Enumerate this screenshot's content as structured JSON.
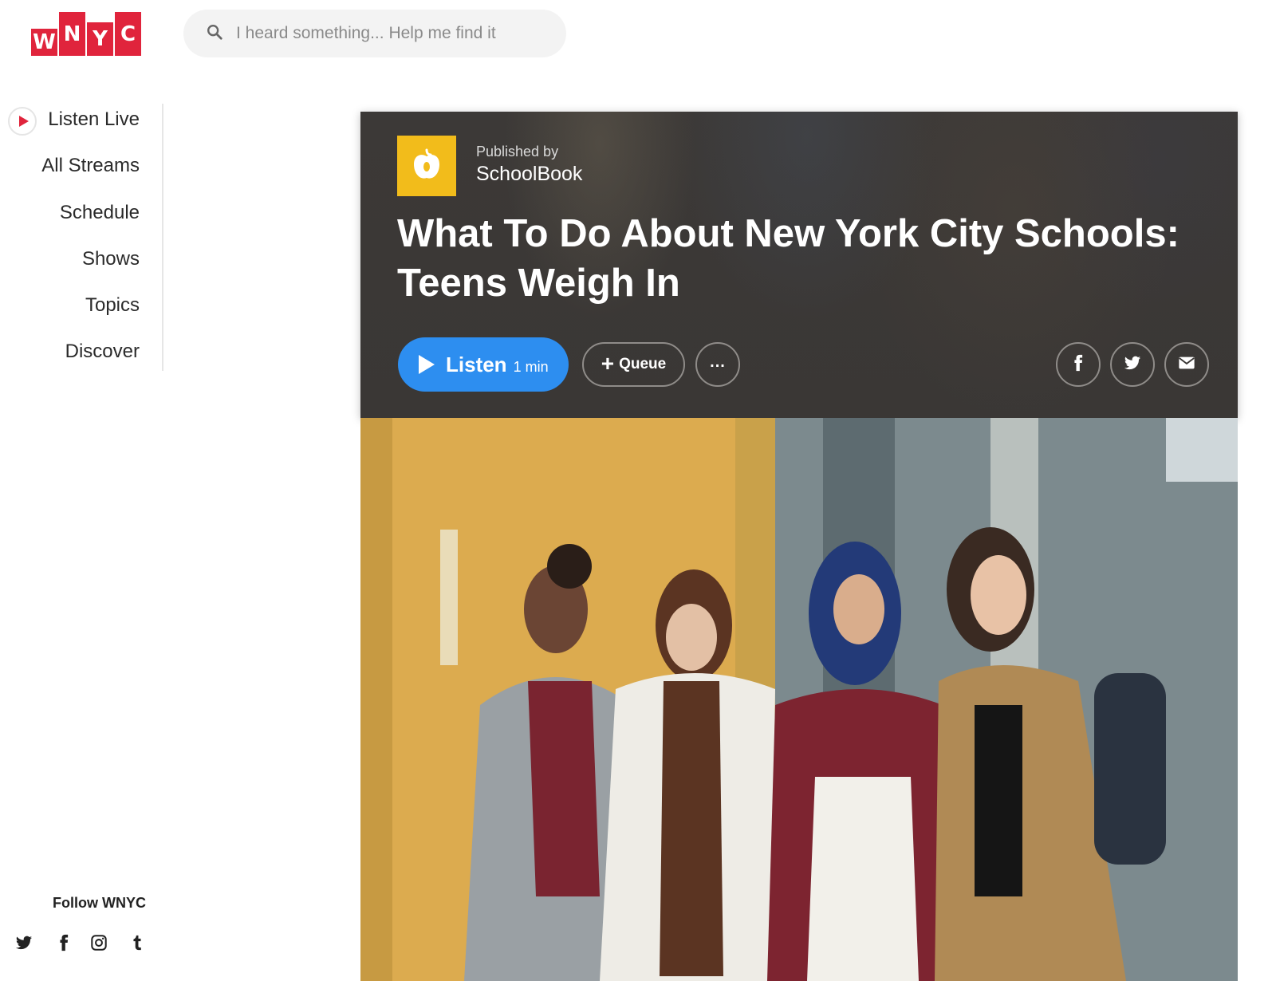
{
  "logo": {
    "letters": [
      "W",
      "N",
      "Y",
      "C"
    ]
  },
  "search": {
    "placeholder": "I heard something... Help me find it"
  },
  "nav": {
    "items": [
      {
        "label": "Listen Live"
      },
      {
        "label": "All Streams"
      },
      {
        "label": "Schedule"
      },
      {
        "label": "Shows"
      },
      {
        "label": "Topics"
      },
      {
        "label": "Discover"
      }
    ]
  },
  "footer": {
    "follow_label": "Follow WNYC",
    "social_icons": [
      "twitter-icon",
      "facebook-icon",
      "instagram-icon",
      "tumblr-icon"
    ]
  },
  "article": {
    "published_by_label": "Published by",
    "publisher": "SchoolBook",
    "publisher_icon": "apple-icon",
    "title": "What To Do About New York City Schools: Teens Weigh In",
    "listen_label": "Listen",
    "duration": "1 min",
    "queue_label": "Queue",
    "more_label": "...",
    "share_icons": [
      "facebook-icon",
      "twitter-icon",
      "email-icon"
    ]
  },
  "colors": {
    "brand_red": "#e0243c",
    "listen_blue": "#2d8ef0",
    "publisher_yellow": "#f2bc1b",
    "hero_background": "#3b3836"
  }
}
